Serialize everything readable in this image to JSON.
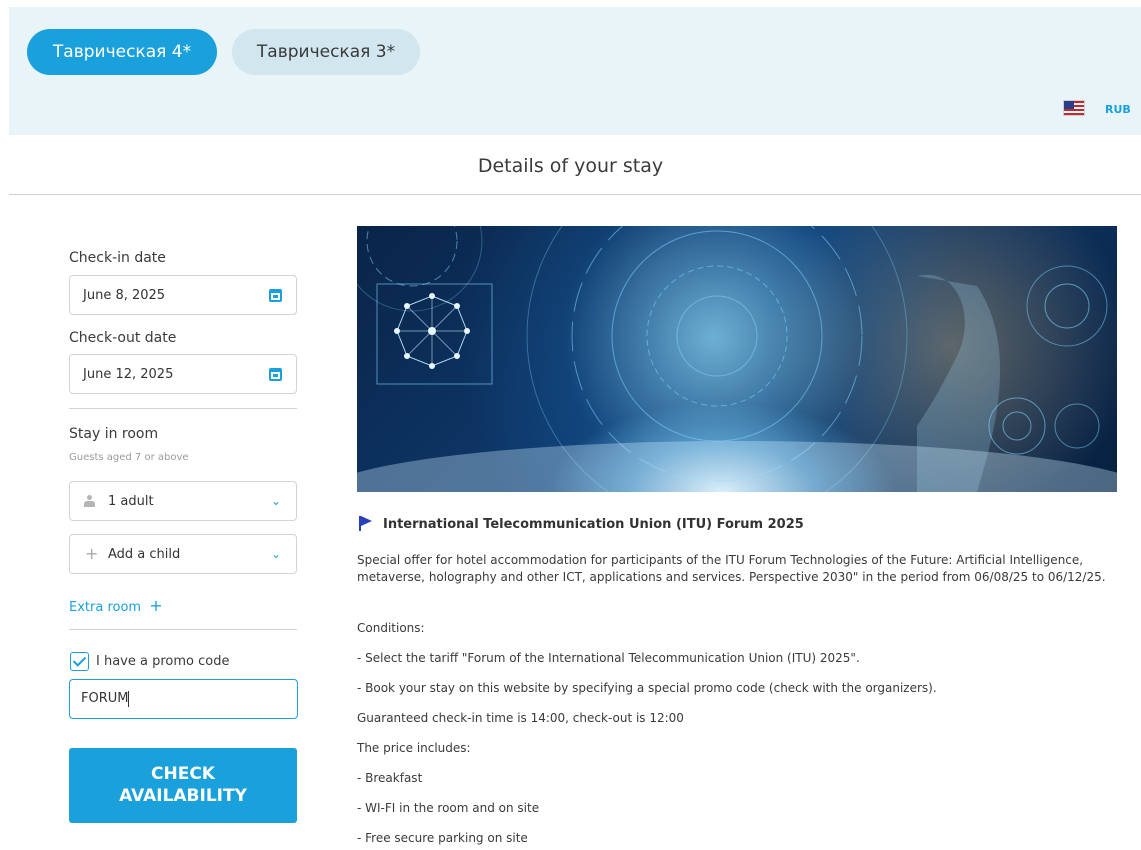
{
  "tabs": [
    {
      "label": "Таврическая 4*",
      "active": true
    },
    {
      "label": "Таврическая 3*",
      "active": false
    }
  ],
  "currency": "RUB",
  "language_icon": "us-flag-icon",
  "page_title": "Details of your stay",
  "form": {
    "checkin_label": "Check-in date",
    "checkin_value": "June 8, 2025",
    "checkout_label": "Check-out date",
    "checkout_value": "June 12, 2025",
    "stay_label": "Stay in room",
    "guests_note": "Guests aged 7 or above",
    "adults_value": "1 adult",
    "child_placeholder": "Add a child",
    "extra_room_label": "Extra room",
    "promo_checkbox_label": "I have a promo code",
    "promo_checked": true,
    "promo_value": "FORUM",
    "check_button_line1": "CHECK",
    "check_button_line2": "AVAILABILITY"
  },
  "event": {
    "title": "International Telecommunication Union (ITU) Forum 2025",
    "description": "Special offer for hotel accommodation for participants of the ITU Forum Technologies of the Future: Artificial Intelligence, metaverse, holography and other ICT, applications and services. Perspective 2030\" in the period from 06/08/25 to 06/12/25.",
    "lines": [
      "Conditions:",
      "- Select the tariff \"Forum of the International Telecommunication Union (ITU) 2025\".",
      "- Book your stay on this website by specifying a special promo code (check with the organizers).",
      "Guaranteed check-in time is 14:00, check-out is 12:00",
      "The price includes:",
      "- Breakfast",
      "- WI-FI in the room and on site",
      "- Free secure parking on site"
    ]
  },
  "colors": {
    "accent": "#1aa1dc",
    "topbar_bg": "#e8f4f8",
    "inactive_tab_bg": "#d2e6ef"
  }
}
